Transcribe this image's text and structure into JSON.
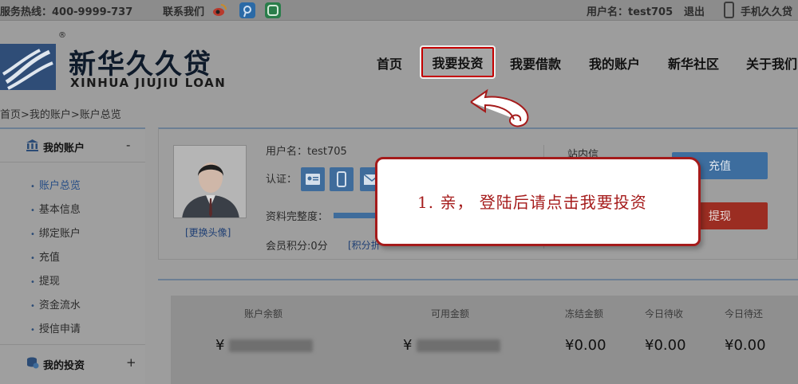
{
  "topbar": {
    "hotline": "服务热线：400-9999-737",
    "contact": "联系我们",
    "username": "用户名：test705",
    "logout": "退出",
    "mobile": "手机久久贷",
    "icons": [
      "weibo-icon",
      "tencent-weibo-icon",
      "wechat-icon",
      "phone-icon"
    ]
  },
  "logo": {
    "cn": "新华久久贷",
    "en": "XINHUA JIUJIU LOAN",
    "reg": "®"
  },
  "nav": {
    "items": [
      "首页",
      "我要投资",
      "我要借款",
      "我的账户",
      "新华社区",
      "关于我们"
    ],
    "active": "我要投资"
  },
  "breadcrumb": "首页>我的账户>账户总览",
  "sidebar": {
    "section_title": "我的账户",
    "section_toggle": "-",
    "items": [
      "账户总览",
      "基本信息",
      "绑定账户",
      "充值",
      "提现",
      "资金流水",
      "授信申请"
    ],
    "active_item": "账户总览",
    "section2_title": "我的投资",
    "section2_toggle": "+"
  },
  "profile": {
    "username": "用户名：test705",
    "auth_label": "认证：",
    "change_avatar": "[更换头像]",
    "completeness_label": "资料完整度：",
    "completeness": 0.35,
    "points": "会员积分:0分",
    "points_link": "[积分折",
    "station_msg": "站内信",
    "recharge": "充值",
    "withdraw": "提现"
  },
  "stats": {
    "labels": [
      "账户余额",
      "可用金额",
      "冻结金额",
      "今日待收",
      "今日待还"
    ],
    "currency": "¥",
    "values": [
      "0.00",
      "0.00",
      "0.00"
    ]
  },
  "callout": {
    "text": "1. 亲， 登陆后请点击我要投资"
  },
  "colors": {
    "accent_blue": "#3d6d9e",
    "danger_red": "#9b2d22",
    "callout_red": "#a51b1b"
  }
}
